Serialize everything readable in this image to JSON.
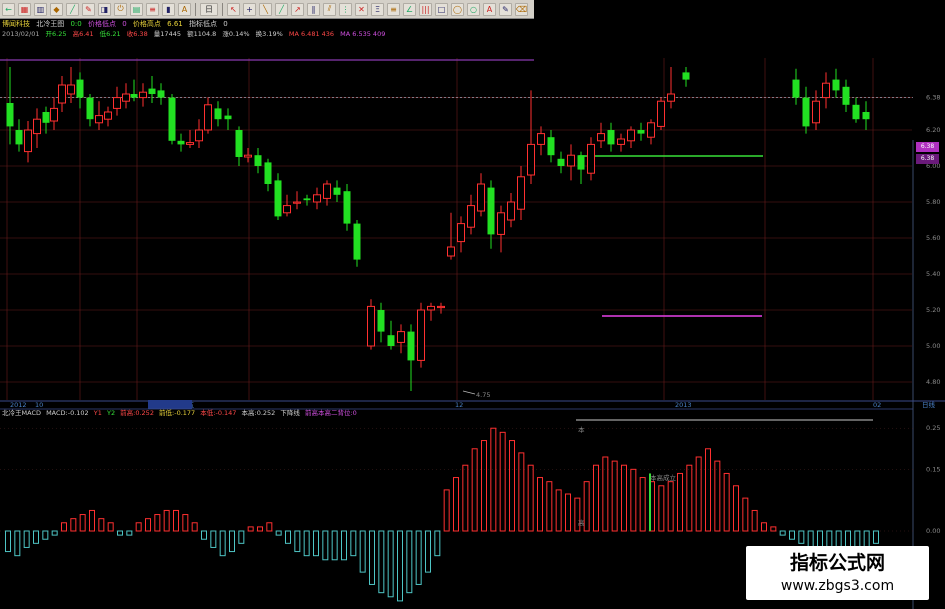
{
  "toolbar": {
    "buttons": [
      {
        "name": "back-icon",
        "glyph": "←"
      },
      {
        "name": "grid-icon",
        "glyph": "▦"
      },
      {
        "name": "chart-icon",
        "glyph": "▥"
      },
      {
        "name": "pin-icon",
        "glyph": "◆"
      },
      {
        "name": "line-icon",
        "glyph": "╱"
      },
      {
        "name": "draw-icon",
        "glyph": "✎"
      },
      {
        "name": "indicator-icon",
        "glyph": "◨"
      },
      {
        "name": "power-icon",
        "glyph": "⏻"
      },
      {
        "name": "window-icon",
        "glyph": "▤"
      },
      {
        "name": "list-icon",
        "glyph": "≡"
      },
      {
        "name": "bars-icon",
        "glyph": "▮"
      },
      {
        "name": "text-icon",
        "glyph": "A"
      }
    ],
    "period_label": "日",
    "tools": [
      {
        "name": "pointer-icon",
        "glyph": "↖"
      },
      {
        "name": "cross-icon",
        "glyph": "+"
      },
      {
        "name": "segment-icon",
        "glyph": "╲"
      },
      {
        "name": "ray-icon",
        "glyph": "╱"
      },
      {
        "name": "arrow-icon",
        "glyph": "↗"
      },
      {
        "name": "parallel-icon",
        "glyph": "∥"
      },
      {
        "name": "channel-icon",
        "glyph": "⫽"
      },
      {
        "name": "vline-icon",
        "glyph": "⋮"
      },
      {
        "name": "gann-icon",
        "glyph": "✕"
      },
      {
        "name": "fib-icon",
        "glyph": "Ξ"
      },
      {
        "name": "hline-icon",
        "glyph": "≡"
      },
      {
        "name": "angle-icon",
        "glyph": "∠"
      },
      {
        "name": "period-icon",
        "glyph": "|||"
      },
      {
        "name": "rect-icon",
        "glyph": "□"
      },
      {
        "name": "ellipse-icon",
        "glyph": "◯"
      },
      {
        "name": "circle-icon",
        "glyph": "○"
      },
      {
        "name": "textbox-icon",
        "glyph": "A"
      },
      {
        "name": "pen-icon",
        "glyph": "✎"
      },
      {
        "name": "eraser-icon",
        "glyph": "⌫"
      }
    ]
  },
  "header": {
    "stock_name": "博闻科技",
    "indicator": "北冷王图",
    "param_1": "0:0",
    "param_2": "价格低点",
    "param_2_value": "0",
    "param_3": "价格高点",
    "param_3_value": "6.61",
    "param_4": "指标低点",
    "param_4_value": "0"
  },
  "quote": {
    "date": "2013/02/01",
    "open": "开6.25",
    "high": "高6.41",
    "low": "低6.21",
    "close": "收6.38",
    "volume": "量17445",
    "amount": "额1104.8",
    "change": "涨0.14%",
    "turnover": "换3.19%",
    "ma_a": "MA 6.481 436",
    "ma_b": "MA 6.535 409"
  },
  "price_axis": [
    "6.38",
    "6.20",
    "6.00",
    "5.80",
    "5.60",
    "5.40",
    "5.20",
    "5.00",
    "4.80"
  ],
  "price_tag": "6.38",
  "price_tag_2": "6.38",
  "low_label": "4.75",
  "dates": [
    "2012",
    "10",
    "12/10/27 周五",
    "12",
    "2013",
    "02"
  ],
  "sub_indicator": {
    "title": "北冷王MACD",
    "macd": "MACD:-0.102",
    "v1": "Y1",
    "v2": "Y2",
    "dif": "前高:0.252",
    "dea": "前低:-0.177",
    "min": "本低:-0.147",
    "top": "本高:0.252",
    "down": "下降线",
    "tip": "前高本高二背位:0"
  },
  "macd_axis": [
    "0.25",
    "0.15",
    "0.00"
  ],
  "macd_labels": {
    "top": "本",
    "bottom": "高",
    "cross": "本高成立"
  },
  "right_blue": "日线",
  "watermark": {
    "title": "指标公式网",
    "url": "www.zbgs3.com"
  },
  "colors": {
    "up": "#ff3030",
    "down": "#22e022",
    "grid": "#6a1d1d",
    "macd_neg": "#4ec5c5",
    "accent": "#b030c0"
  },
  "candles": [
    [
      6.35,
      6.22,
      6.55,
      6.12
    ],
    [
      6.2,
      6.12,
      6.26,
      6.08
    ],
    [
      6.08,
      6.2,
      6.25,
      6.02
    ],
    [
      6.18,
      6.26,
      6.32,
      6.1
    ],
    [
      6.3,
      6.24,
      6.33,
      6.18
    ],
    [
      6.25,
      6.32,
      6.38,
      6.2
    ],
    [
      6.35,
      6.45,
      6.5,
      6.3
    ],
    [
      6.4,
      6.45,
      6.55,
      6.35
    ],
    [
      6.48,
      6.38,
      6.52,
      6.32
    ],
    [
      6.38,
      6.26,
      6.4,
      6.22
    ],
    [
      6.24,
      6.28,
      6.36,
      6.2
    ],
    [
      6.26,
      6.3,
      6.33,
      6.22
    ],
    [
      6.32,
      6.38,
      6.44,
      6.28
    ],
    [
      6.36,
      6.4,
      6.46,
      6.32
    ],
    [
      6.4,
      6.38,
      6.48,
      6.36
    ],
    [
      6.38,
      6.41,
      6.46,
      6.33
    ],
    [
      6.43,
      6.4,
      6.5,
      6.35
    ],
    [
      6.42,
      6.38,
      6.46,
      6.34
    ],
    [
      6.38,
      6.14,
      6.4,
      6.12
    ],
    [
      6.14,
      6.12,
      6.18,
      6.08
    ],
    [
      6.12,
      6.13,
      6.2,
      6.1
    ],
    [
      6.14,
      6.2,
      6.26,
      6.1
    ],
    [
      6.2,
      6.34,
      6.38,
      6.18
    ],
    [
      6.32,
      6.26,
      6.36,
      6.22
    ],
    [
      6.28,
      6.26,
      6.32,
      6.2
    ],
    [
      6.2,
      6.05,
      6.22,
      6.0
    ],
    [
      6.05,
      6.06,
      6.1,
      6.02
    ],
    [
      6.06,
      6.0,
      6.1,
      5.96
    ],
    [
      6.02,
      5.9,
      6.04,
      5.86
    ],
    [
      5.92,
      5.72,
      5.96,
      5.7
    ],
    [
      5.74,
      5.78,
      5.84,
      5.72
    ],
    [
      5.8,
      5.8,
      5.86,
      5.76
    ],
    [
      5.82,
      5.81,
      5.84,
      5.78
    ],
    [
      5.8,
      5.84,
      5.88,
      5.76
    ],
    [
      5.82,
      5.9,
      5.92,
      5.78
    ],
    [
      5.88,
      5.84,
      5.92,
      5.8
    ],
    [
      5.86,
      5.68,
      5.9,
      5.64
    ],
    [
      5.68,
      5.48,
      5.7,
      5.44
    ],
    [
      5.0,
      5.22,
      5.26,
      4.98
    ],
    [
      5.2,
      5.08,
      5.24,
      5.02
    ],
    [
      5.06,
      5.0,
      5.14,
      4.98
    ],
    [
      5.02,
      5.08,
      5.12,
      4.96
    ],
    [
      5.08,
      4.92,
      5.12,
      4.75
    ],
    [
      4.92,
      5.2,
      5.24,
      4.88
    ],
    [
      5.2,
      5.22,
      5.24,
      5.14
    ],
    [
      5.22,
      5.22,
      5.24,
      5.18
    ],
    [
      5.5,
      5.55,
      5.74,
      5.48
    ],
    [
      5.58,
      5.68,
      5.72,
      5.52
    ],
    [
      5.66,
      5.78,
      5.84,
      5.62
    ],
    [
      5.75,
      5.9,
      5.96,
      5.72
    ],
    [
      5.88,
      5.62,
      5.92,
      5.54
    ],
    [
      5.62,
      5.74,
      5.78,
      5.52
    ],
    [
      5.7,
      5.8,
      5.85,
      5.66
    ],
    [
      5.76,
      5.94,
      6.0,
      5.7
    ],
    [
      5.95,
      6.12,
      6.42,
      5.9
    ],
    [
      6.12,
      6.18,
      6.22,
      6.06
    ],
    [
      6.16,
      6.06,
      6.2,
      6.02
    ],
    [
      6.04,
      6.0,
      6.08,
      5.96
    ],
    [
      6.0,
      6.06,
      6.12,
      5.92
    ],
    [
      6.06,
      5.98,
      6.08,
      5.9
    ],
    [
      5.96,
      6.12,
      6.16,
      5.92
    ],
    [
      6.14,
      6.18,
      6.24,
      6.1
    ],
    [
      6.2,
      6.12,
      6.24,
      6.08
    ],
    [
      6.12,
      6.15,
      6.18,
      6.08
    ],
    [
      6.14,
      6.2,
      6.22,
      6.1
    ],
    [
      6.2,
      6.18,
      6.24,
      6.14
    ],
    [
      6.16,
      6.24,
      6.26,
      6.12
    ],
    [
      6.22,
      6.36,
      6.38,
      6.2
    ],
    [
      6.36,
      6.4,
      6.55,
      6.32
    ],
    [
      6.52,
      6.48,
      6.55,
      6.44
    ],
    [
      6.48,
      6.38,
      6.54,
      6.34
    ],
    [
      6.38,
      6.22,
      6.44,
      6.18
    ],
    [
      6.24,
      6.36,
      6.42,
      6.2
    ],
    [
      6.38,
      6.46,
      6.52,
      6.32
    ],
    [
      6.48,
      6.42,
      6.54,
      6.38
    ],
    [
      6.44,
      6.34,
      6.48,
      6.3
    ],
    [
      6.34,
      6.26,
      6.38,
      6.24
    ],
    [
      6.3,
      6.26,
      6.36,
      6.2
    ]
  ],
  "candle_x": [
    10,
    19,
    28,
    37,
    46,
    54,
    62,
    71,
    80,
    90,
    99,
    108,
    117,
    126,
    134,
    143,
    152,
    161,
    172,
    181,
    190,
    199,
    208,
    218,
    228,
    239,
    248,
    258,
    268,
    278,
    287,
    297,
    307,
    317,
    327,
    337,
    347,
    357,
    371,
    381,
    391,
    401,
    411,
    421,
    431,
    441,
    451,
    461,
    471,
    481,
    491,
    501,
    511,
    521,
    531,
    541,
    551,
    561,
    571,
    581,
    591,
    601,
    611,
    621,
    631,
    641,
    651,
    661,
    671,
    686,
    796,
    806,
    816,
    826,
    836,
    846,
    856,
    866
  ],
  "macd": [
    -0.05,
    -0.06,
    -0.04,
    -0.03,
    -0.02,
    -0.01,
    0.02,
    0.03,
    0.04,
    0.05,
    0.03,
    0.02,
    -0.01,
    -0.01,
    0.02,
    0.03,
    0.04,
    0.05,
    0.05,
    0.04,
    0.02,
    -0.02,
    -0.04,
    -0.06,
    -0.05,
    -0.03,
    0.01,
    0.01,
    0.02,
    -0.01,
    -0.03,
    -0.05,
    -0.06,
    -0.06,
    -0.07,
    -0.07,
    -0.07,
    -0.06,
    -0.1,
    -0.13,
    -0.15,
    -0.16,
    -0.17,
    -0.15,
    -0.13,
    -0.1,
    -0.06,
    0.1,
    0.13,
    0.16,
    0.2,
    0.22,
    0.25,
    0.24,
    0.22,
    0.19,
    0.16,
    0.13,
    0.12,
    0.1,
    0.09,
    0.08,
    0.12,
    0.16,
    0.18,
    0.17,
    0.16,
    0.15,
    0.13,
    0.12,
    0.11,
    0.12,
    0.14,
    0.16,
    0.18,
    0.2,
    0.17,
    0.14,
    0.11,
    0.08,
    0.05,
    0.02,
    0.01,
    -0.01,
    -0.02,
    -0.03,
    -0.04,
    -0.04,
    -0.04,
    -0.04,
    -0.04,
    -0.04,
    -0.04,
    -0.03
  ]
}
